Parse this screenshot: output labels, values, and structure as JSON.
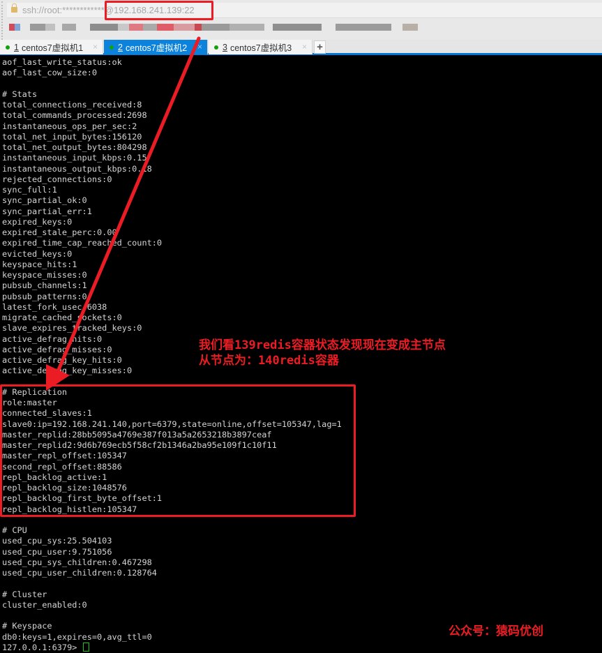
{
  "address_bar": {
    "url": "ssh://root:************@192.168.241.139:22",
    "lock_icon": "lock-icon"
  },
  "tabs": [
    {
      "number": "1",
      "label": "centos7虚拟机1",
      "status_color": "#13a10e",
      "active": false
    },
    {
      "number": "2",
      "label": "centos7虚拟机2",
      "status_color": "#13a10e",
      "active": true
    },
    {
      "number": "3",
      "label": "centos7虚拟机3",
      "status_color": "#13a10e",
      "active": false
    }
  ],
  "tab_controls": {
    "close_icon": "×",
    "new_tab": "+"
  },
  "terminal": {
    "lines": [
      "aof_last_write_status:ok",
      "aof_last_cow_size:0",
      "",
      "# Stats",
      "total_connections_received:8",
      "total_commands_processed:2698",
      "instantaneous_ops_per_sec:2",
      "total_net_input_bytes:156120",
      "total_net_output_bytes:804298",
      "instantaneous_input_kbps:0.15",
      "instantaneous_output_kbps:0.18",
      "rejected_connections:0",
      "sync_full:1",
      "sync_partial_ok:0",
      "sync_partial_err:1",
      "expired_keys:0",
      "expired_stale_perc:0.00",
      "expired_time_cap_reached_count:0",
      "evicted_keys:0",
      "keyspace_hits:1",
      "keyspace_misses:0",
      "pubsub_channels:1",
      "pubsub_patterns:0",
      "latest_fork_usec:6038",
      "migrate_cached_sockets:0",
      "slave_expires_tracked_keys:0",
      "active_defrag_hits:0",
      "active_defrag_misses:0",
      "active_defrag_key_hits:0",
      "active_defrag_key_misses:0",
      "",
      "# Replication",
      "role:master",
      "connected_slaves:1",
      "slave0:ip=192.168.241.140,port=6379,state=online,offset=105347,lag=1",
      "master_replid:28bb5095a4769e387f013a5a2653218b3897ceaf",
      "master_replid2:9d6b769ecb5f58cf2b1346a2ba95e109f1c10f11",
      "master_repl_offset:105347",
      "second_repl_offset:88586",
      "repl_backlog_active:1",
      "repl_backlog_size:1048576",
      "repl_backlog_first_byte_offset:1",
      "repl_backlog_histlen:105347",
      "",
      "# CPU",
      "used_cpu_sys:25.504103",
      "used_cpu_user:9.751056",
      "used_cpu_sys_children:0.467298",
      "used_cpu_user_children:0.128764",
      "",
      "# Cluster",
      "cluster_enabled:0",
      "",
      "# Keyspace",
      "db0:keys=1,expires=0,avg_ttl=0"
    ],
    "prompt": "127.0.0.1:6379> "
  },
  "annotations": {
    "main_line1": "我们看139redis容器状态发现现在变成主节点",
    "main_line2": "从节点为：140redis容器",
    "signature": "公众号：猿码优创",
    "color": "#ec1c24"
  }
}
